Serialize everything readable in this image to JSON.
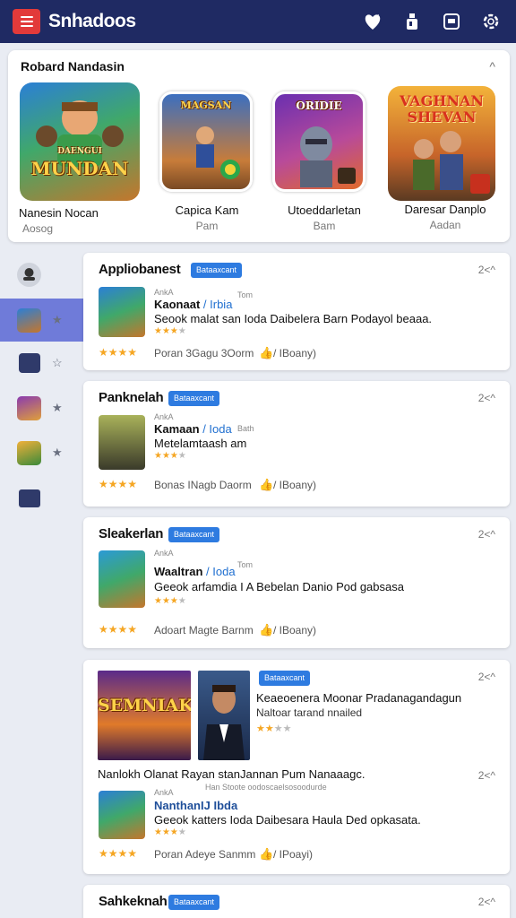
{
  "header": {
    "title": "Snhadoos",
    "icons": [
      "menu-icon",
      "heart-shield-icon",
      "bottle-icon",
      "window-icon",
      "settings-icon"
    ]
  },
  "featured": {
    "title": "Robard Nandasin",
    "collapse": "^",
    "items": [
      {
        "name": "Nanesin Nocan",
        "sub": "Aosog",
        "art": "MUNDAN",
        "art_top": "DAENGUI"
      },
      {
        "name": "Capica Kam",
        "sub": "Pam",
        "art": "MAGSAN"
      },
      {
        "name": "Utoeddarletan",
        "sub": "Bam",
        "art": "ORIDIE"
      },
      {
        "name": "Daresar Danplo",
        "sub": "Aadan",
        "art": "VAGHNAN SHEVAN"
      }
    ]
  },
  "sidebar": {
    "items": [
      "user-icon",
      "game-thumb",
      "chat-icon",
      "game-thumb",
      "game-thumb",
      "card-icon"
    ]
  },
  "cards": [
    {
      "title": "Appliobanest",
      "badge": "Bataaxcant",
      "collapse": "2<^",
      "tiny1": "AnkA",
      "tiny2": "Tom",
      "app_name": "Kaonaat",
      "app_cat": " / Irbia",
      "desc": "Seook malat san Ioda Daibelera Barn Podayol beaaa.",
      "rating": "Poran 3Gagu 3Oorm",
      "tag": "/ IBoany)",
      "stars": 4
    },
    {
      "title": "Panknelah",
      "badge": "Bataaxcant",
      "collapse": "2<^",
      "tiny1": "AnkA",
      "tiny2": "Bath",
      "app_name": "Kamaan",
      "app_cat": " / Ioda",
      "desc": "Metelamtaash am",
      "rating": "Bonas INagb Daorm",
      "tag": "/ IBoany)",
      "stars": 4
    },
    {
      "title": "Sleakerlan",
      "badge": "Bataaxcant",
      "collapse": "2<^",
      "tiny1": "AnkA",
      "tiny2": "Tom",
      "app_name": "Waaltran",
      "app_cat": " / Ioda",
      "desc": "Geeok arfamdia I A Bebelan Danio Pod gabsasa",
      "rating": "Adoart Magte Barnm",
      "tag": "/ IBoany)",
      "stars": 4
    },
    {
      "promo_badge": "Bataaxcant",
      "collapse": "2<^",
      "promo_title": "Keaeoenera Moonar Pradanagandagun",
      "promo_sub": "Naltoar tarand nnailed",
      "promo_art": "SEMNIAK",
      "line": "Nanlokh Olanat Rayan stanJannan Pum Nanaaagc.",
      "line_tiny": "Han Stoote oodoscaelsosoodurde",
      "collapse2": "2<^",
      "tiny1": "AnkA",
      "app_name": "NanthanIJ Ibda",
      "desc": "Geeok katters Ioda Daibesara Haula Ded opkasata.",
      "rating": "Poran Adeye Sanmm",
      "tag": "/ IPoayi)",
      "stars": 4
    },
    {
      "title": "Sahkeknah",
      "badge": "Bataaxcant",
      "collapse": "2<^"
    }
  ],
  "colors": {
    "topbar": "#1f2a63",
    "accent": "#2e7be0",
    "menu": "#e23a3a",
    "sidebar_active": "#6f7bd9",
    "star": "#f5a623"
  }
}
